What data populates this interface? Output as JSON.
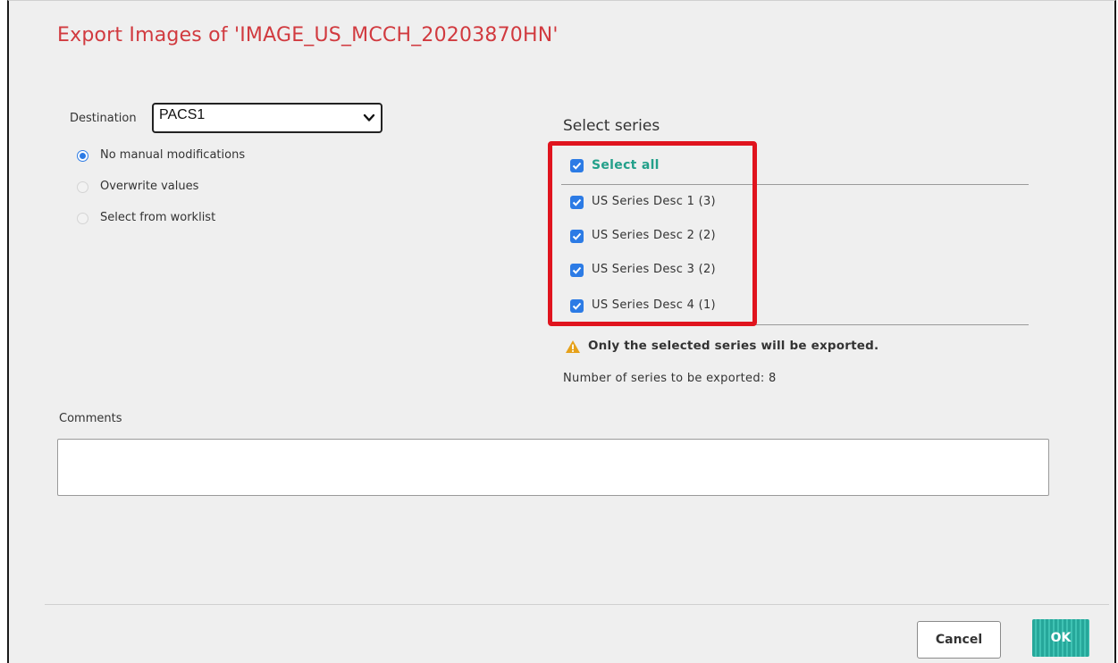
{
  "dialog": {
    "title": "Export Images of 'IMAGE_US_MCCH_20203870HN'"
  },
  "destination": {
    "label": "Destination",
    "value": "PACS1"
  },
  "modification_options": [
    {
      "label": "No manual modifications",
      "checked": true
    },
    {
      "label": "Overwrite values",
      "checked": false
    },
    {
      "label": "Select from worklist",
      "checked": false
    }
  ],
  "series": {
    "title": "Select series",
    "select_all_label": "Select all",
    "items": [
      {
        "label": "US Series Desc 1 (3)",
        "checked": true
      },
      {
        "label": "US Series Desc 2 (2)",
        "checked": true
      },
      {
        "label": "US Series Desc 3 (2)",
        "checked": true
      },
      {
        "label": "US Series Desc 4 (1)",
        "checked": true
      }
    ],
    "warning": "Only the selected series will be exported.",
    "count_text": "Number of series to be exported: 8"
  },
  "comments": {
    "label": "Comments",
    "value": ""
  },
  "footer": {
    "cancel_label": "Cancel",
    "ok_label": "OK"
  },
  "colors": {
    "title": "#d13a3f",
    "checkbox": "#2c7be5",
    "select_all": "#23a08a",
    "highlight_box": "#e0141e",
    "ok_button": "#26a79a"
  }
}
